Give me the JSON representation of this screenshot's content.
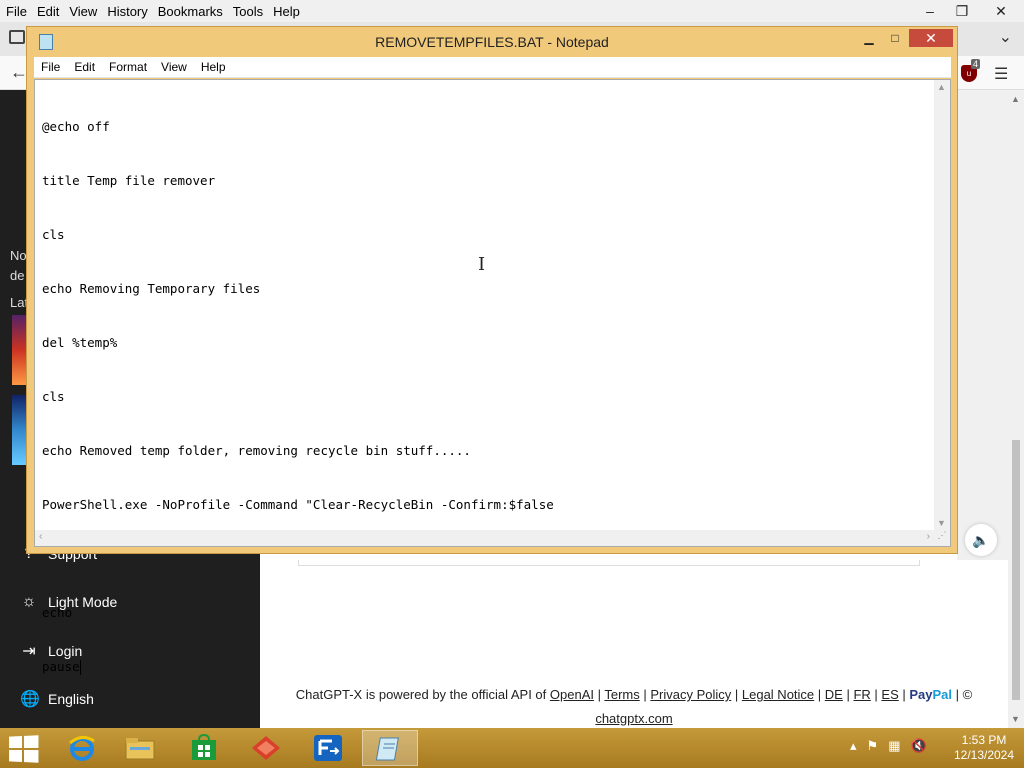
{
  "browser": {
    "menu": [
      "File",
      "Edit",
      "View",
      "History",
      "Bookmarks",
      "Tools",
      "Help"
    ],
    "window_buttons": {
      "minimize": "–",
      "maximize": "❐",
      "close": "✕"
    },
    "ublock_badge": "4"
  },
  "notepad": {
    "title": "REMOVETEMPFILES.BAT - Notepad",
    "menu": [
      "File",
      "Edit",
      "Format",
      "View",
      "Help"
    ],
    "lines": [
      "@echo off",
      "title Temp file remover",
      "cls",
      "echo Removing Temporary files",
      "del %temp%",
      "cls",
      "echo Removed temp folder, removing recycle bin stuff.....",
      "PowerShell.exe -NoProfile -Command \"Clear-RecycleBin -Confirm:$false",
      "",
      "echo",
      "pause"
    ]
  },
  "sidebar": {
    "partial_texts": [
      "No",
      "de",
      "Lat"
    ],
    "items": [
      {
        "label": "Support",
        "icon": "support-icon"
      },
      {
        "label": "Light Mode",
        "icon": "sun-icon"
      },
      {
        "label": "Login",
        "icon": "login-icon"
      },
      {
        "label": "English",
        "icon": "globe-icon"
      }
    ]
  },
  "footer": {
    "prefix": "ChatGPT-X is powered by the official API of",
    "openai": "OpenAI",
    "terms": "Terms",
    "privacy": "Privacy Policy",
    "legal": "Legal Notice",
    "de": "DE",
    "fr": "FR",
    "es": "ES",
    "paypal_1": "Pay",
    "paypal_2": "Pal",
    "copyright": "©",
    "site": "chatgptx.com"
  },
  "taskbar": {
    "apps": [
      "internet-explorer",
      "file-explorer",
      "store",
      "app-red",
      "app-blue",
      "notepad"
    ],
    "time": "1:53 PM",
    "date": "12/13/2024"
  },
  "colors": {
    "notepad_frame": "#f0c97a",
    "close_button": "#c74b3c",
    "taskbar": "#b88a2c",
    "sidebar": "#1f1f1f"
  }
}
